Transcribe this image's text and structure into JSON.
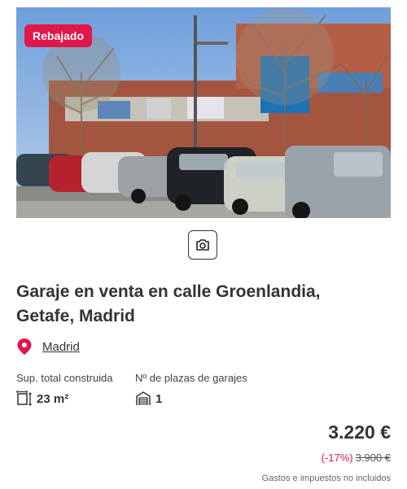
{
  "listing": {
    "badge": "Rebajado",
    "title": "Garaje en venta en calle Groenlandia, Getafe, Madrid",
    "location": "Madrid",
    "features": [
      {
        "label": "Sup. total construida",
        "value": "23 m²",
        "icon": "area-icon"
      },
      {
        "label": "Nº de plazas de garajes",
        "value": "1",
        "icon": "garage-icon"
      }
    ],
    "price": "3.220 €",
    "discount_percent": "(-17%)",
    "old_price": "3.900 €",
    "taxes_note": "Gastos e impuestos no incluidos"
  },
  "colors": {
    "accent": "#e0174a",
    "text": "#333333"
  },
  "icons": {
    "camera": "camera-icon",
    "location": "map-pin-icon"
  }
}
